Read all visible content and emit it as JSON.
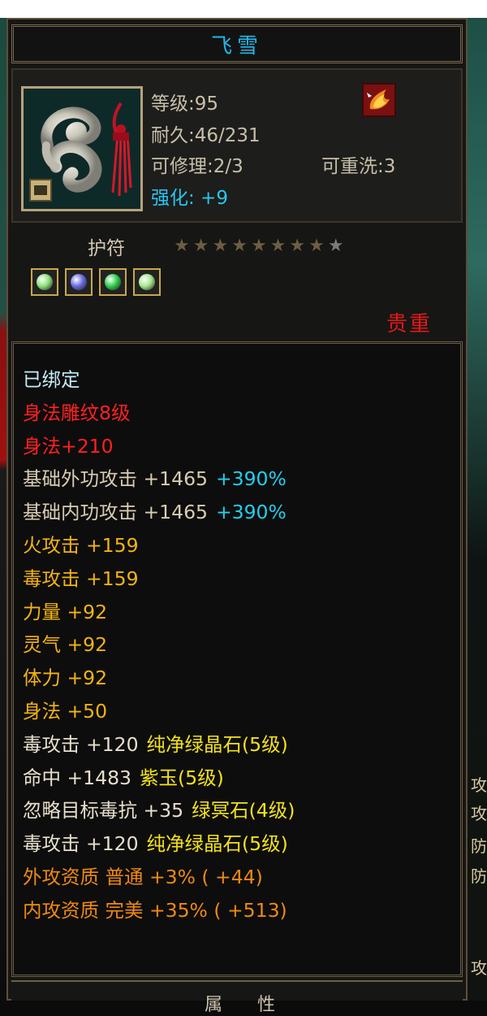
{
  "item": {
    "name": "飞雪",
    "level": "等级:95",
    "durability": "耐久:46/231",
    "repairable": "可修理:2/3",
    "rewash": "可重洗:3",
    "enhance": "强化: +9",
    "type": "护符",
    "stars_total": 9,
    "stars_filled": 8,
    "rarity": "贵重"
  },
  "gems": [
    {
      "name": "green-gem-icon",
      "color": "#8de07a"
    },
    {
      "name": "purple-gem-icon",
      "color": "#6a6ae0"
    },
    {
      "name": "emerald-gem-icon",
      "color": "#2fcf4a"
    },
    {
      "name": "green-gem-icon",
      "color": "#a6e88c"
    }
  ],
  "properties": [
    {
      "text": "已绑定",
      "color": "#c4ecf4"
    },
    {
      "text": "身法雕纹8级",
      "color": "#ff2020"
    },
    {
      "text": "身法+210",
      "color": "#ff2020"
    },
    {
      "text": "基础外功攻击 +1465",
      "color": "#d9ccb1",
      "extra": "+390%",
      "extra_color": "#20d0f0"
    },
    {
      "text": "基础内功攻击 +1465",
      "color": "#d9ccb1",
      "extra": "+390%",
      "extra_color": "#20d0f0"
    },
    {
      "text": "火攻击 +159",
      "color": "#f3b411"
    },
    {
      "text": "毒攻击 +159",
      "color": "#f3b411"
    },
    {
      "text": "力量 +92",
      "color": "#f3b411"
    },
    {
      "text": "灵气 +92",
      "color": "#f3b411"
    },
    {
      "text": "体力 +92",
      "color": "#f3b411"
    },
    {
      "text": "身法 +50",
      "color": "#f3b411"
    },
    {
      "text": "毒攻击 +120",
      "color": "#e8e0cc",
      "extra": "纯净绿晶石(5级)",
      "extra_color": "#f3e21a"
    },
    {
      "text": "命中 +1483",
      "color": "#e8e0cc",
      "extra": "紫玉(5级)",
      "extra_color": "#f3e21a"
    },
    {
      "text": "忽略目标毒抗 +35",
      "color": "#e8e0cc",
      "extra": "绿冥石(4级)",
      "extra_color": "#f3e21a"
    },
    {
      "text": "毒攻击 +120",
      "color": "#e8e0cc",
      "extra": "纯净绿晶石(5级)",
      "extra_color": "#f3e21a"
    },
    {
      "text": "外攻资质 普通 +3% ( +44)",
      "color": "#f08a10"
    },
    {
      "text": "内攻资质 完美 +35% ( +513)",
      "color": "#f08a10"
    }
  ],
  "footer": {
    "label": "属 性"
  },
  "right_edge": [
    "攻",
    "攻",
    "防",
    "防",
    "攻"
  ]
}
